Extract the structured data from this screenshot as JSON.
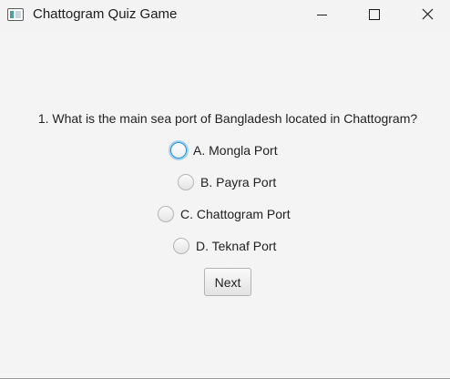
{
  "window": {
    "title": "Chattogram Quiz Game",
    "controls": [
      "minimize-icon",
      "maximize-icon",
      "close-icon"
    ]
  },
  "quiz": {
    "question": "1. What is the main sea port of Bangladesh located in Chattogram?",
    "options": [
      {
        "label": "A. Mongla Port",
        "focused": true
      },
      {
        "label": "B. Payra Port",
        "focused": false
      },
      {
        "label": "C. Chattogram Port",
        "focused": false
      },
      {
        "label": "D. Teknaf Port",
        "focused": false
      }
    ],
    "next_label": "Next"
  },
  "colors": {
    "background": "#f4f4f4",
    "focus_ring": "#2a8fd0"
  }
}
